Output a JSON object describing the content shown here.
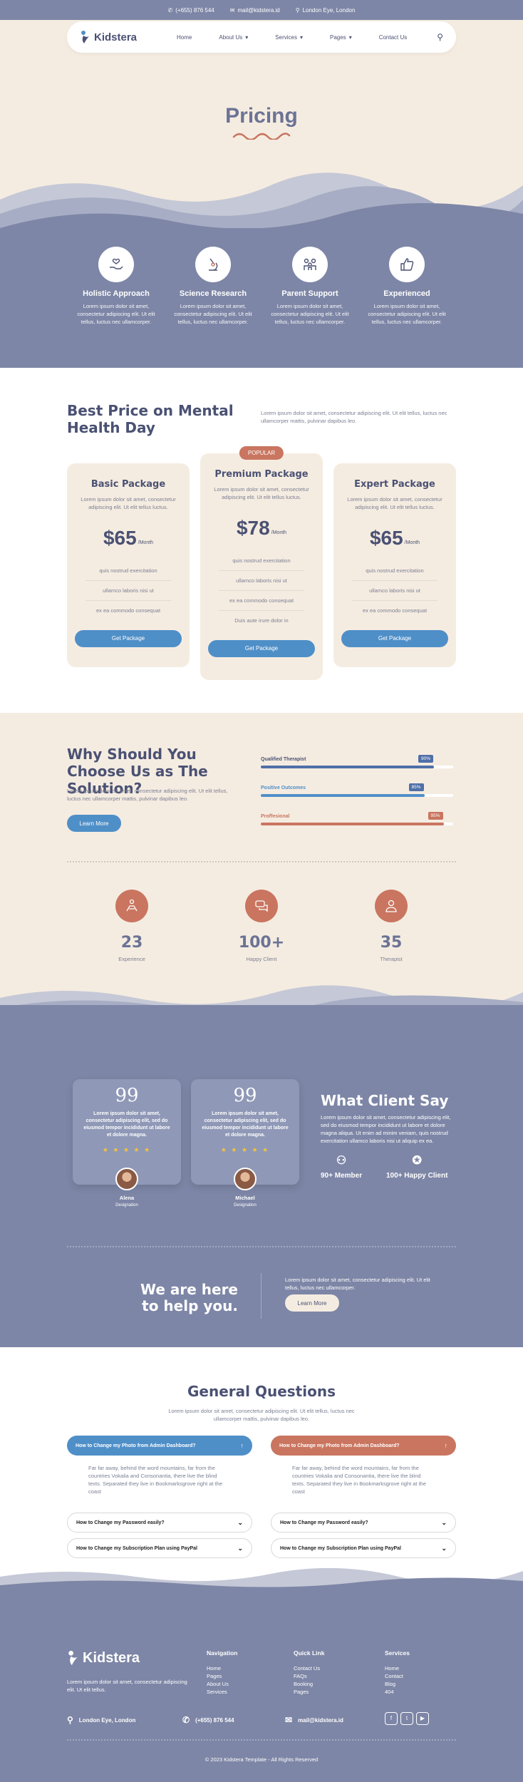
{
  "topbar": {
    "phone": "(+655) 876 544",
    "email": "mail@kidstera.id",
    "location": "London Eye, London"
  },
  "nav": {
    "brand": "Kidstera",
    "links": [
      "Home",
      "About Us",
      "Services",
      "Pages",
      "Contact Us"
    ]
  },
  "hero": {
    "title": "Pricing"
  },
  "features": [
    {
      "icon": "hand-heart-icon",
      "title": "Holistic Approach",
      "text": "Lorem ipsum dolor sit amet, consectetur adipiscing elit. Ut elit tellus, luctus nec ullamcorper."
    },
    {
      "icon": "microscope-icon",
      "title": "Science Research",
      "text": "Lorem ipsum dolor sit amet, consectetur adipiscing elit. Ut elit tellus, luctus nec ullamcorper."
    },
    {
      "icon": "family-icon",
      "title": "Parent Support",
      "text": "Lorem ipsum dolor sit amet, consectetur adipiscing elit. Ut elit tellus, luctus nec ullamcorper."
    },
    {
      "icon": "thumbs-up-icon",
      "title": "Experienced",
      "text": "Lorem ipsum dolor sit amet, consectetur adipiscing elit. Ut elit tellus, luctus nec ullamcorper."
    }
  ],
  "pricing": {
    "heading": "Best Price on Mental Health Day",
    "intro": "Lorem ipsum dolor sit amet, consectetur adipiscing elit. Ut elit tellus, luctus nec ullamcorper mattis, pulvinar dapibus leo.",
    "popular_label": "POPULAR",
    "plans": [
      {
        "name": "Basic Package",
        "desc": "Lorem ipsum dolor sit amet, consectetur adipiscing elit. Ut elit tellus luctus.",
        "price": "$65",
        "period": "/Month",
        "features": [
          "quis nostrud exercitation",
          "ullamco laboris nisi ut",
          "ex ea commodo consequat"
        ],
        "button": "Get Package"
      },
      {
        "name": "Premium Package",
        "desc": "Lorem ipsum dolor sit amet, consectetur adipiscing elit. Ut elit tellus luctus.",
        "price": "$78",
        "period": "/Month",
        "features": [
          "quis nostrud exercitation",
          "ullamco laboris nisi ut",
          "ex ea commodo consequat",
          "Duis aute irure dolor in"
        ],
        "button": "Get Package"
      },
      {
        "name": "Expert Package",
        "desc": "Lorem ipsum dolor sit amet, consectetur adipiscing elit. Ut elit tellus luctus.",
        "price": "$65",
        "period": "/Month",
        "features": [
          "quis nostrud exercitation",
          "ullamco laboris nisi ut",
          "ex ea commodo consequat"
        ],
        "button": "Get Package"
      }
    ]
  },
  "why": {
    "heading": "Why Should You Choose Us as The Solution?",
    "text": "Lorem ipsum dolor sit amet, consectetur adipiscing elit. Ut elit tellus, luctus nec ullamcorper mattis, pulvinar dapibus leo.",
    "button": "Learn More",
    "skills": [
      {
        "label": "Qualified Therapist",
        "percent": 90,
        "percent_text": "90%",
        "color": "#4f6fa8"
      },
      {
        "label": "Positive Outcomes",
        "percent": 85,
        "percent_text": "85%",
        "color": "#4f8fc8"
      },
      {
        "label": "Proffesional",
        "percent": 95,
        "percent_text": "95%",
        "color": "#c97560"
      }
    ],
    "stats": [
      {
        "icon": "therapy-icon",
        "number": "23",
        "label": "Experience"
      },
      {
        "icon": "chat-icon",
        "number": "100+",
        "label": "Happy Client"
      },
      {
        "icon": "therapist-icon",
        "number": "35",
        "label": "Therapist"
      }
    ]
  },
  "testimonials": {
    "cards": [
      {
        "quote": "Lorem ipsum dolor sit amet, consectetur adipiscing elit, sed do eiusmod tempor incididunt ut labore et dolore magna.",
        "rating": 5,
        "name": "Alena",
        "role": "Designation"
      },
      {
        "quote": "Lorem ipsum dolor sit amet, consectetur adipiscing elit, sed do eiusmod tempor incididunt ut labore et dolore magna.",
        "rating": 5,
        "name": "Michael",
        "role": "Designation"
      }
    ],
    "heading": "What Client Say",
    "text": "Lorem ipsum dolor sit amet, consectetur adipiscing elit, sed do eiusmod tempor incididunt ut labore et dolore magna aliqua. Ut enim ad minim veniam, quis nostrud exercitation ullamco laboris nisi ut aliquip ex ea.",
    "kpis": [
      "90+ Member",
      "100+ Happy Client"
    ],
    "stars": "★ ★ ★ ★ ★",
    "quote_mark": "99"
  },
  "help": {
    "heading": "We are here to help you.",
    "text": "Lorem ipsum dolor sit amet, consectetur adipiscing elit. Ut elit tellus, luctus nec ullamcorper.",
    "button": "Learn More"
  },
  "faq": {
    "heading": "General Questions",
    "sub": "Lorem ipsum dolor sit amet, consectetur adipiscing elit. Ut elit tellus, luctus nec ullamcorper mattis, pulvinar dapibus leo.",
    "left": [
      {
        "q": "How to Change my Photo from Admin Dashboard?",
        "open": true,
        "a": "Far far away, behind the word mountains, far from the countries Vokalia and Consonantia, there live the blind texts. Separated they live in Bookmarksgrove right at the coast"
      },
      {
        "q": "How to Change my Password easily?",
        "open": false
      },
      {
        "q": "How to Change my Subscription Plan using PayPal",
        "open": false
      }
    ],
    "right": [
      {
        "q": "How to Change my Photo from Admin Dashboard?",
        "open": true,
        "a": "Far far away, behind the word mountains, far from the countries Vokalia and Consonantia, there live the blind texts. Separated they live in Bookmarksgrove right at the coast"
      },
      {
        "q": "How to Change my Password easily?",
        "open": false
      },
      {
        "q": "How to Change my Subscription Plan using PayPal",
        "open": false
      }
    ]
  },
  "footer": {
    "brand": "Kidstera",
    "about": "Lorem ipsum dolor sit amet, consectetur adipiscing elit. Ut elit tellus.",
    "columns": [
      {
        "title": "Navigation",
        "links": [
          "Home",
          "Pages",
          "About Us",
          "Services"
        ]
      },
      {
        "title": "Quick Link",
        "links": [
          "Contact Us",
          "FAQs",
          "Booking",
          "Pages"
        ]
      },
      {
        "title": "Services",
        "links": [
          "Home",
          "Contact",
          "Blog",
          "404"
        ]
      }
    ],
    "location": "London Eye, London",
    "phone": "(+655) 876 544",
    "email": "mail@kidstera.id",
    "copyright": "© 2023 Kidstera Template - All Rights Reserved"
  },
  "colors": {
    "primary": "#7d86a6",
    "cream": "#f5ece1",
    "accent": "#c97560",
    "blue": "#4f8fc8",
    "text": "#4a5173"
  }
}
